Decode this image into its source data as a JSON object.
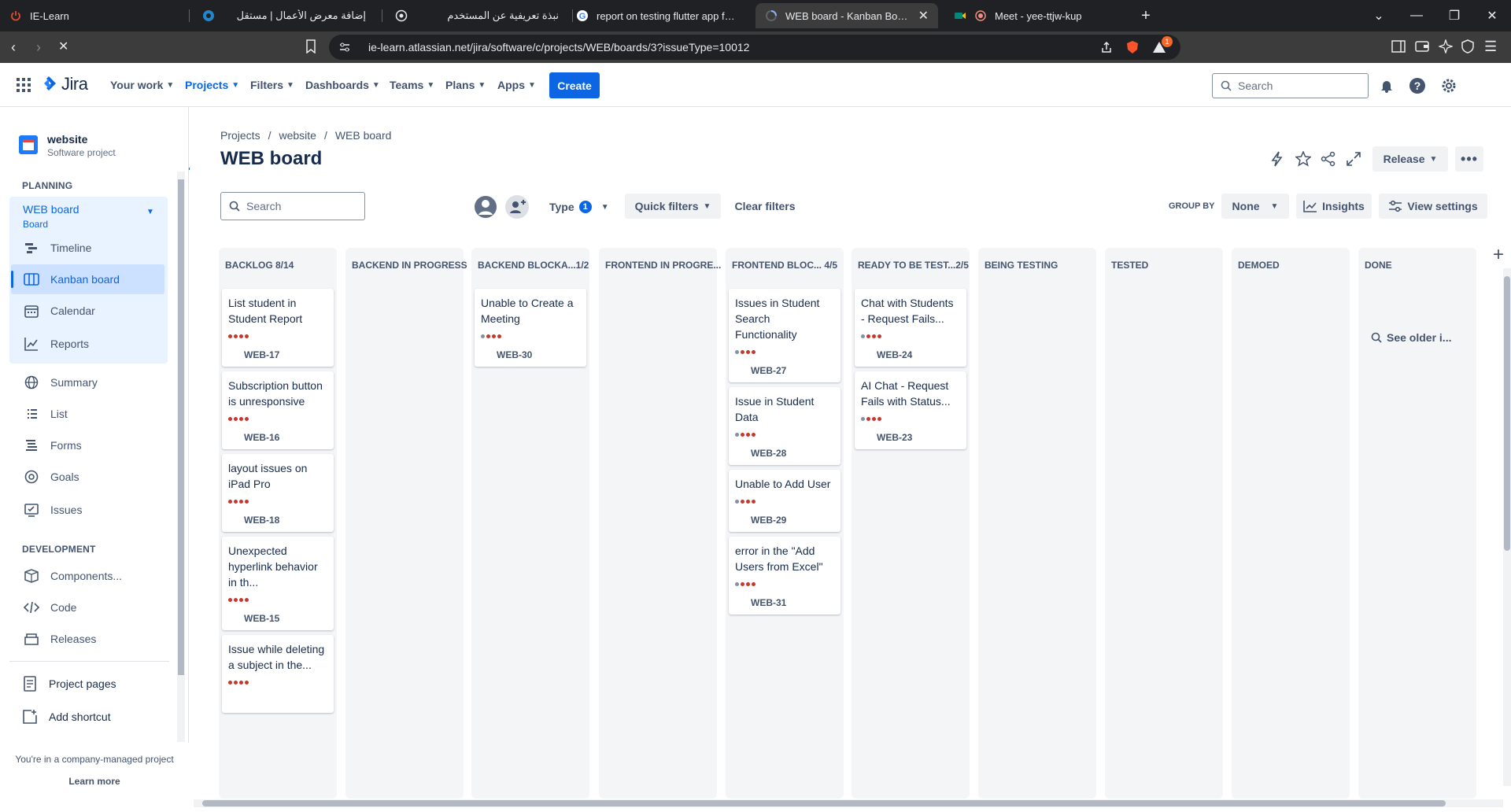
{
  "browser": {
    "tabs": [
      {
        "title": "IE-Learn"
      },
      {
        "title": "إضافة معرض الأعمال | مستقل"
      },
      {
        "title": "نبذة تعريفية عن المستخدم"
      },
      {
        "title": "report on testing flutter app for mo"
      },
      {
        "title": "WEB board - Kanban Board - Jira"
      },
      {
        "title": "Meet - yee-ttjw-kup"
      }
    ],
    "url": "ie-learn.atlassian.net/jira/software/c/projects/WEB/boards/3?issueType=10012",
    "badge_count": "1"
  },
  "nav": {
    "product": "Jira",
    "items": [
      "Your work",
      "Projects",
      "Filters",
      "Dashboards",
      "Teams",
      "Plans",
      "Apps"
    ],
    "create": "Create",
    "search_placeholder": "Search"
  },
  "sidebar": {
    "project_name": "website",
    "project_type": "Software project",
    "planning_label": "PLANNING",
    "board_name": "WEB board",
    "board_sub": "Board",
    "planning_items": [
      "Timeline",
      "Kanban board",
      "Calendar",
      "Reports"
    ],
    "other_items": [
      "Summary",
      "List",
      "Forms",
      "Goals",
      "Issues"
    ],
    "development_label": "DEVELOPMENT",
    "dev_items": [
      "Components...",
      "Code",
      "Releases"
    ],
    "footer_items": [
      "Project pages",
      "Add shortcut"
    ],
    "company_note": "You're in a company-managed project",
    "learn_more": "Learn more"
  },
  "board": {
    "breadcrumb": [
      "Projects",
      "website",
      "WEB board"
    ],
    "title": "WEB board",
    "release": "Release",
    "search_placeholder": "Search",
    "type_label": "Type",
    "type_count": "1",
    "quick_filters": "Quick filters",
    "clear_filters": "Clear filters",
    "group_by_label": "GROUP BY",
    "group_by_value": "None",
    "insights": "Insights",
    "view_settings": "View settings",
    "see_older": "See older i...",
    "columns": [
      {
        "name": "BACKLOG 8/14",
        "count": "",
        "cards": [
          {
            "title": "List student in Student Report",
            "key": "WEB-17"
          },
          {
            "title": "Subscription button is unresponsive",
            "key": "WEB-16"
          },
          {
            "title": "layout issues on iPad Pro",
            "key": "WEB-18"
          },
          {
            "title": "Unexpected hyperlink behavior in th...",
            "key": "WEB-15"
          },
          {
            "title": "Issue while deleting a subject in the...",
            "key": ""
          }
        ]
      },
      {
        "name": "BACKEND IN PROGRESS",
        "count": "",
        "cards": []
      },
      {
        "name": "BACKEND BLOCKA...",
        "count": "1/2",
        "cards": [
          {
            "title": "Unable to Create a Meeting",
            "key": "WEB-30"
          }
        ]
      },
      {
        "name": "FRONTEND IN PROGRE...",
        "count": "",
        "cards": []
      },
      {
        "name": "FRONTEND BLOC...",
        "count": "4/5",
        "cards": [
          {
            "title": "Issues in Student Search Functionality",
            "key": "WEB-27"
          },
          {
            "title": "Issue in Student Data",
            "key": "WEB-28"
          },
          {
            "title": "Unable to Add User",
            "key": "WEB-29"
          },
          {
            "title": "error in the \"Add Users from Excel\"",
            "key": "WEB-31"
          }
        ]
      },
      {
        "name": "READY TO BE TEST...",
        "count": "2/5",
        "cards": [
          {
            "title": "Chat with Students - Request Fails...",
            "key": "WEB-24"
          },
          {
            "title": "AI Chat - Request Fails with Status...",
            "key": "WEB-23"
          }
        ]
      },
      {
        "name": "BEING TESTING",
        "count": "",
        "cards": []
      },
      {
        "name": "TESTED",
        "count": "",
        "cards": []
      },
      {
        "name": "DEMOED",
        "count": "",
        "cards": []
      },
      {
        "name": "DONE",
        "count": "",
        "cards": []
      }
    ]
  },
  "colors": {
    "accent": "#0c66e4",
    "priority_high": "#c9372c",
    "priority_low": "#8590a2"
  }
}
